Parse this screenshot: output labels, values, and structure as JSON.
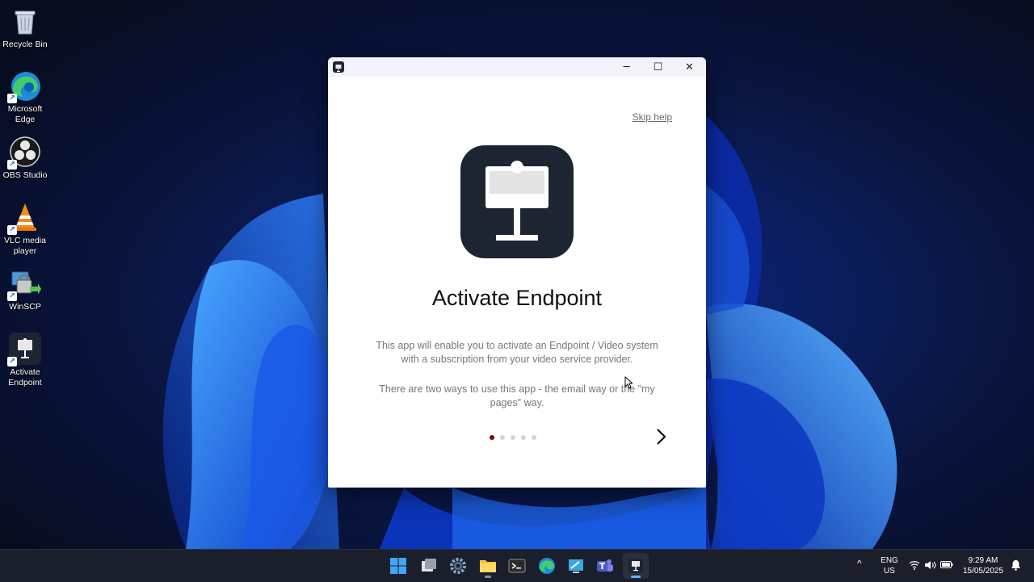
{
  "desktop": {
    "icons": [
      {
        "label": "Recycle Bin"
      },
      {
        "label": "Microsoft Edge"
      },
      {
        "label": "OBS Studio"
      },
      {
        "label": "VLC media player"
      },
      {
        "label": "WinSCP"
      },
      {
        "label": "Activate Endpoint"
      }
    ]
  },
  "window": {
    "icon": "activate-endpoint-app-icon",
    "controls": {
      "minimize": "─",
      "maximize": "☐",
      "close": "✕"
    },
    "skip_help": "Skip help",
    "title": "Activate Endpoint",
    "paragraph1": "This app will enable you to activate an Endpoint / Video system with a subscription from your video service provider.",
    "paragraph2": "There are two ways to use this app - the email way or the \"my pages\" way.",
    "pager": {
      "total": 5,
      "current": 1
    },
    "accent_color": "#7a0b0b",
    "logo_bg": "#1d2432"
  },
  "taskbar": {
    "apps": [
      "start-icon",
      "task-view-icon",
      "settings-icon",
      "file-explorer-icon",
      "terminal-icon",
      "edge-icon",
      "remote-desktop-icon",
      "teams-icon",
      "activate-endpoint-icon"
    ],
    "tray": {
      "chevron": "^",
      "lang_top": "ENG",
      "lang_bottom": "US",
      "time": "9:29 AM",
      "date": "15/05/2025"
    }
  }
}
